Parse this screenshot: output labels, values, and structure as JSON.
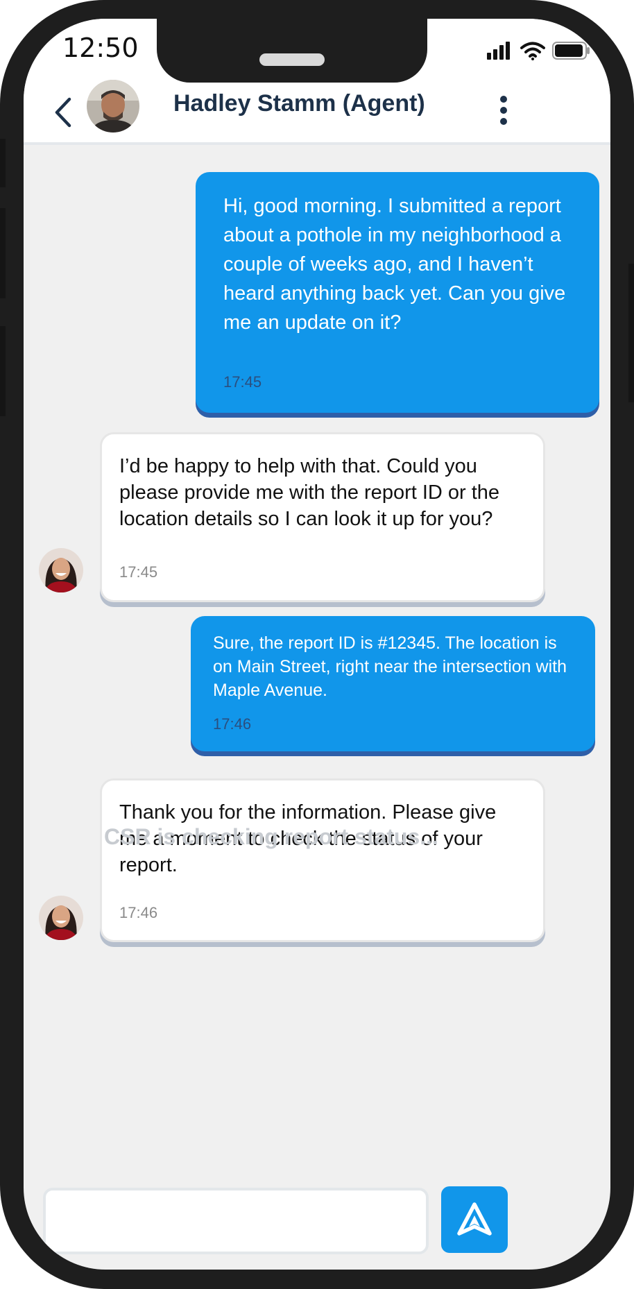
{
  "status_bar": {
    "time": "12:50",
    "icons": [
      "signal-icon",
      "wifi-icon",
      "battery-icon"
    ]
  },
  "header": {
    "back_icon": "chevron-left-icon",
    "contact_name": "Hadley Stamm (Agent)",
    "menu_icon": "more-vertical-icon"
  },
  "messages": [
    {
      "direction": "sent",
      "text": " Hi, good morning. I submitted a report about a pothole in my neighborhood a couple of weeks ago, and I haven’t heard anything back yet. Can you give me an update on it?",
      "time": "17:45"
    },
    {
      "direction": "received",
      "text": "I’d be happy to help with that. Could you please provide me with the report ID or the location details so I can look it up for you?",
      "time": "17:45"
    },
    {
      "direction": "sent",
      "text": "Sure, the report ID is #12345. The location is on Main Street, right near the intersection with Maple Avenue.",
      "time": "17:46"
    },
    {
      "direction": "received",
      "text": "Thank you for the information. Please give me a moment to check the status of your report.",
      "time": "17:46"
    }
  ],
  "typing_indicator": "CSR is checking report status...",
  "composer": {
    "value": "",
    "placeholder": "",
    "send_icon": "send-icon"
  },
  "colors": {
    "sent_bubble": "#1196ea",
    "received_bubble": "#ffffff",
    "header_title": "#1d3149",
    "background": "#f0f0f0"
  }
}
